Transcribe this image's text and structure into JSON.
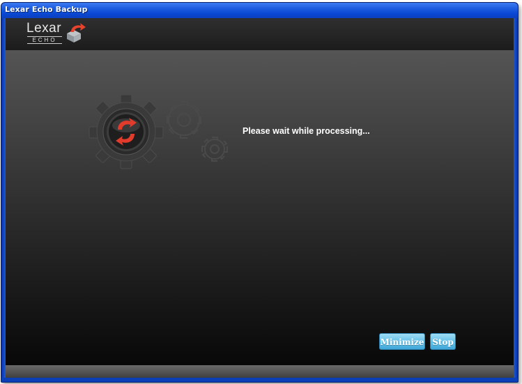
{
  "window": {
    "title": "Lexar Echo Backup"
  },
  "header": {
    "logo_word": "Lexar",
    "logo_sub": "ECHO"
  },
  "main": {
    "status_text": "Please wait while processing...",
    "icons": [
      "sync-gear-icon",
      "gear-icon",
      "small-gear-icon"
    ]
  },
  "buttons": {
    "minimize_label": "Minimize",
    "stop_label": "Stop"
  },
  "colors": {
    "accent": "#5bbbe6",
    "sync_red": "#e13b2b",
    "titlebar_blue": "#0a48d4"
  }
}
